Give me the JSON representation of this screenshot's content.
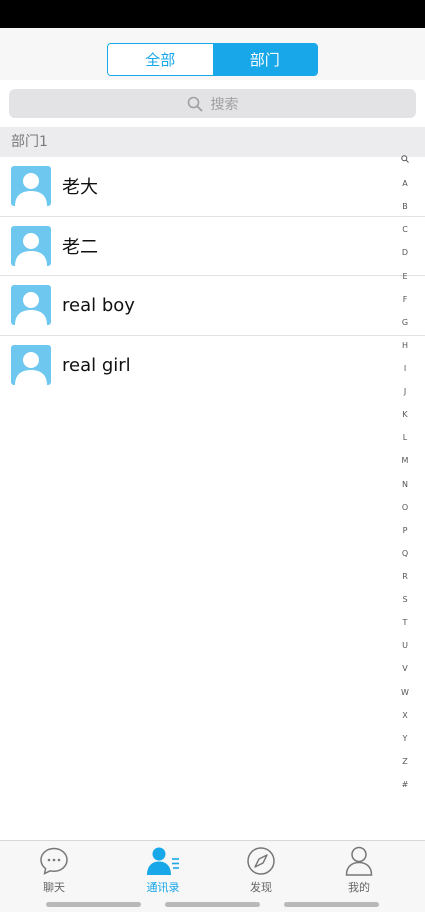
{
  "segment": {
    "all_label": "全部",
    "dept_label": "部门",
    "selected": "部门"
  },
  "search": {
    "placeholder": "搜索"
  },
  "section": {
    "title": "部门1"
  },
  "contacts": [
    {
      "name": "老大"
    },
    {
      "name": "老二"
    },
    {
      "name": "real boy"
    },
    {
      "name": "real girl"
    }
  ],
  "index_letters": [
    "A",
    "B",
    "C",
    "D",
    "E",
    "F",
    "G",
    "H",
    "I",
    "J",
    "K",
    "L",
    "M",
    "N",
    "O",
    "P",
    "Q",
    "R",
    "S",
    "T",
    "U",
    "V",
    "W",
    "X",
    "Y",
    "Z",
    "#"
  ],
  "tabs": [
    {
      "label": "聊天",
      "icon": "chat-bubble-icon"
    },
    {
      "label": "通讯录",
      "icon": "contacts-icon",
      "active": true
    },
    {
      "label": "发现",
      "icon": "compass-icon"
    },
    {
      "label": "我的",
      "icon": "person-icon"
    }
  ],
  "colors": {
    "accent": "#18a7e8",
    "avatar_bg": "#6ec7ef",
    "tab_inactive": "#666666"
  }
}
